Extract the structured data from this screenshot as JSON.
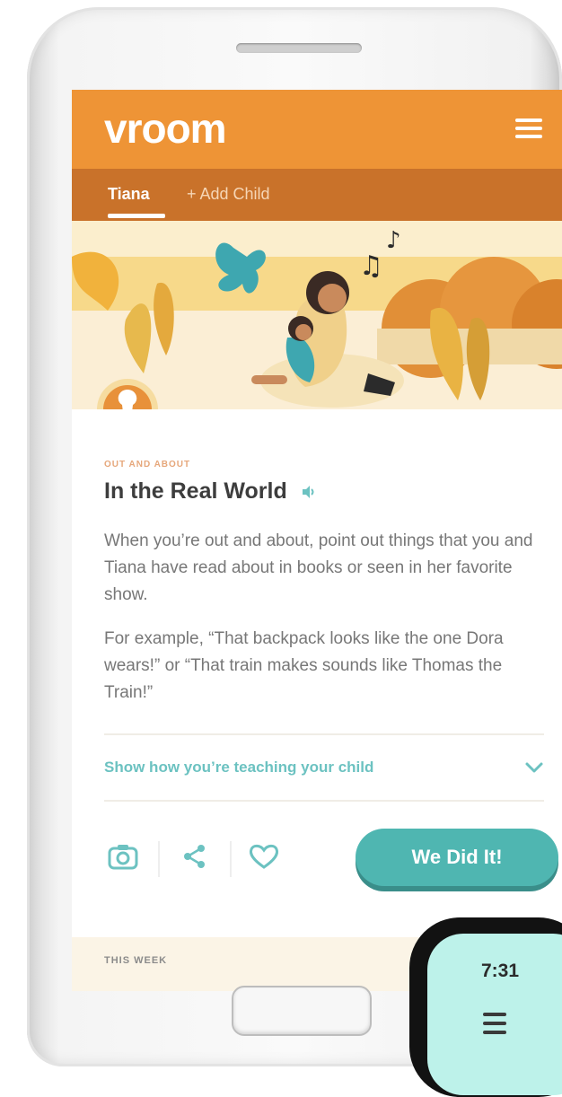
{
  "app": {
    "logo": "vroom",
    "menu_icon": "hamburger-icon"
  },
  "children": {
    "active": "Tiana",
    "add_label": "+ Add Child"
  },
  "activity": {
    "category": "OUT AND ABOUT",
    "title": "In the Real World",
    "audio_icon": "speaker-icon",
    "paragraphs": [
      "When you’re out and about, point out things that you and Tiana have read about in books or seen in her favorite show.",
      "For example, “That backpack looks like the one Dora wears!” or “That train makes sounds like Thomas the Train!”"
    ],
    "teaching_toggle": "Show how you’re teaching your child",
    "actions": {
      "camera_icon": "camera-icon",
      "share_icon": "share-icon",
      "favorite_icon": "heart-icon",
      "did_it_label": "We Did It!"
    }
  },
  "this_week": {
    "label": "THIS WEEK"
  },
  "watch": {
    "time": "7:31",
    "menu_icon": "hamburger-icon"
  },
  "colors": {
    "brand_orange": "#ee9436",
    "child_bar": "#c9722a",
    "teal": "#4fb6b1",
    "teal_text": "#6cc2c1"
  }
}
